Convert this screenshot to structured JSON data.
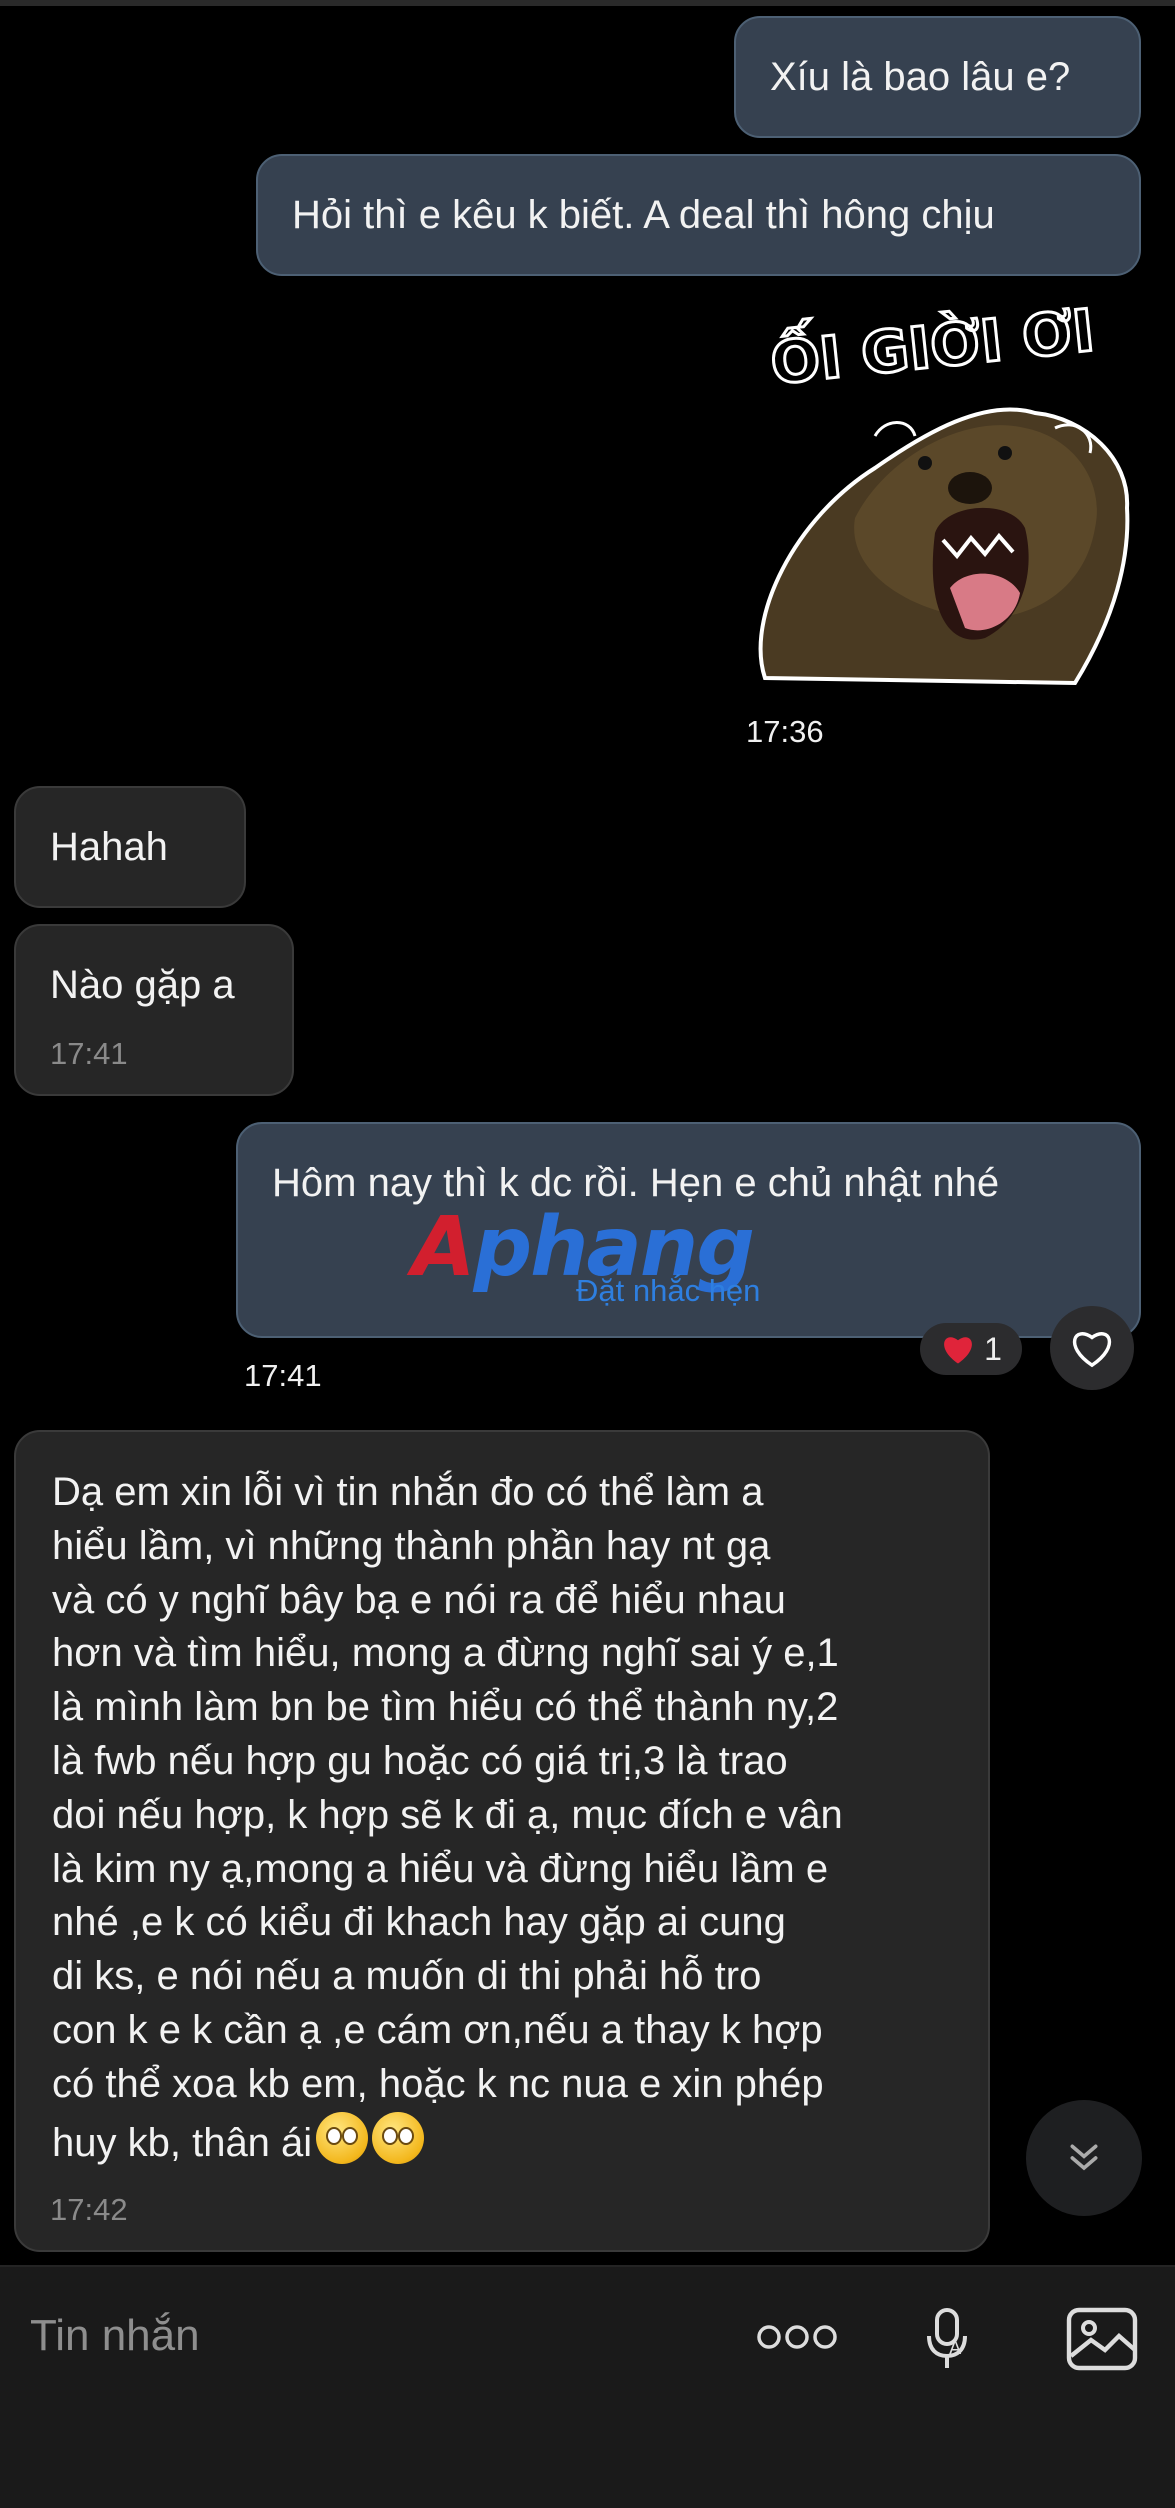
{
  "messages": [
    {
      "text": "Xíu là bao lâu e?"
    },
    {
      "text": "Hỏi thì e kêu k biết. A deal thì hông chịu"
    },
    {
      "sticker_text": "ỐI GIỜI ƠI",
      "time": "17:36"
    },
    {
      "text": "Hahah"
    },
    {
      "text": "Nào gặp a",
      "time": "17:41"
    },
    {
      "text": "Hôm nay thì k dc rồi. Hẹn e chủ nhật nhé",
      "reminder": "Đặt nhắc hẹn",
      "time": "17:41",
      "reaction_count": "1"
    },
    {
      "text": "Dạ em xin lỗi vì tin  nhắn đo có thể làm a\nhiểu lầm, vì những thành phần  hay nt  gạ\nvà có y nghĩ bây bạ  e nói ra để hiểu nhau\nhơn và tìm hiểu, mong  a đừng nghĩ sai ý e,1\nlà mình làm bn be tìm hiểu có thể thành ny,2\nlà fwb nếu hợp gu hoặc có giá trị,3 là trao\ndoi nếu hợp, k hợp sẽ k đi ạ, mục đích e vân\nlà kim ny ạ,mong a hiểu và đừng hiểu lầm e\nnhé ,e k có kiểu đi khach hay  gặp  ai cung\ndi ks, e nói nếu a muốn di thi phải  hỗ tro\ncon  k e k cần ạ ,e cám ơn,nếu a thay  k hợp\ncó thể xoa kb em, hoặc k nc nua e xin phép\nhuy kb, thân ái",
      "time": "17:42"
    }
  ],
  "watermark": {
    "first": "A",
    "rest": "phang"
  },
  "input": {
    "placeholder": "Tin nhắn"
  },
  "colors": {
    "outgoing_bubble": "#364150",
    "incoming_bubble": "#262626",
    "link": "#2e7fe0",
    "reaction_heart": "#e0243a"
  }
}
